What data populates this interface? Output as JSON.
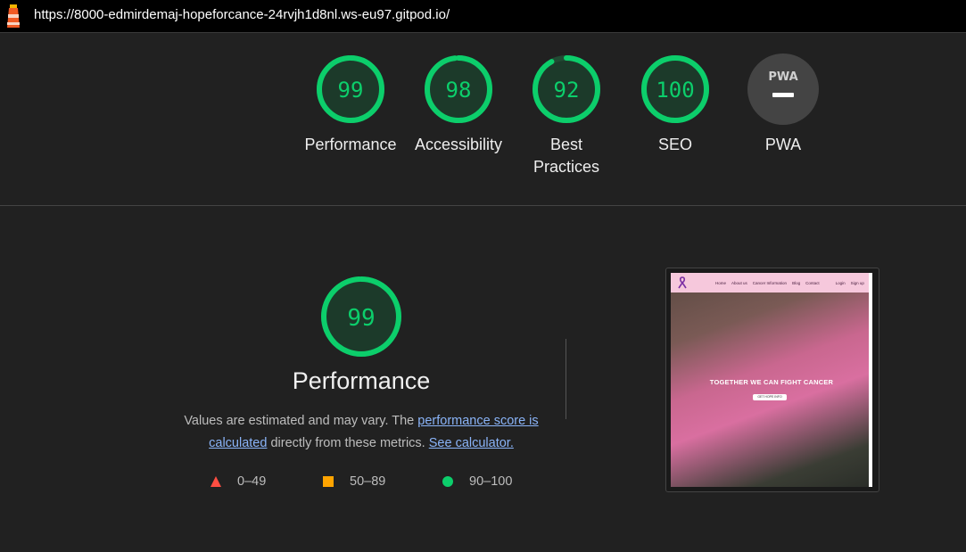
{
  "browser": {
    "url": "https://8000-edmirdemaj-hopeforcance-24rvjh1d8nl.ws-eu97.gitpod.io/"
  },
  "colors": {
    "pass": "#0cce6b",
    "average": "#ffa400",
    "fail": "#ff4e42",
    "na": "#444444"
  },
  "scores": [
    {
      "id": "performance",
      "value": "99",
      "fraction": 0.99,
      "label": "Performance"
    },
    {
      "id": "accessibility",
      "value": "98",
      "fraction": 0.98,
      "label": "Accessibility"
    },
    {
      "id": "best-practices",
      "value": "92",
      "fraction": 0.92,
      "label": "Best Practices"
    },
    {
      "id": "seo",
      "value": "100",
      "fraction": 1.0,
      "label": "SEO"
    },
    {
      "id": "pwa",
      "value": "PWA",
      "label": "PWA"
    }
  ],
  "performance_section": {
    "score": "99",
    "fraction": 0.99,
    "title": "Performance",
    "desc_prefix": "Values are estimated and may vary. The ",
    "link1": "performance score is calculated",
    "desc_middle": " directly from these metrics. ",
    "link2": "See calculator."
  },
  "legend": [
    {
      "range": "0–49",
      "icon": "triangle-icon"
    },
    {
      "range": "50–89",
      "icon": "square-icon"
    },
    {
      "range": "90–100",
      "icon": "circle-icon"
    }
  ],
  "screenshot": {
    "nav_items": [
      "Home",
      "About us",
      "Cancer Information",
      "Blog",
      "Contact",
      "Login",
      "Sign up"
    ],
    "headline": "TOGETHER WE CAN FIGHT CANCER",
    "button": "GET HOPE INFO"
  }
}
